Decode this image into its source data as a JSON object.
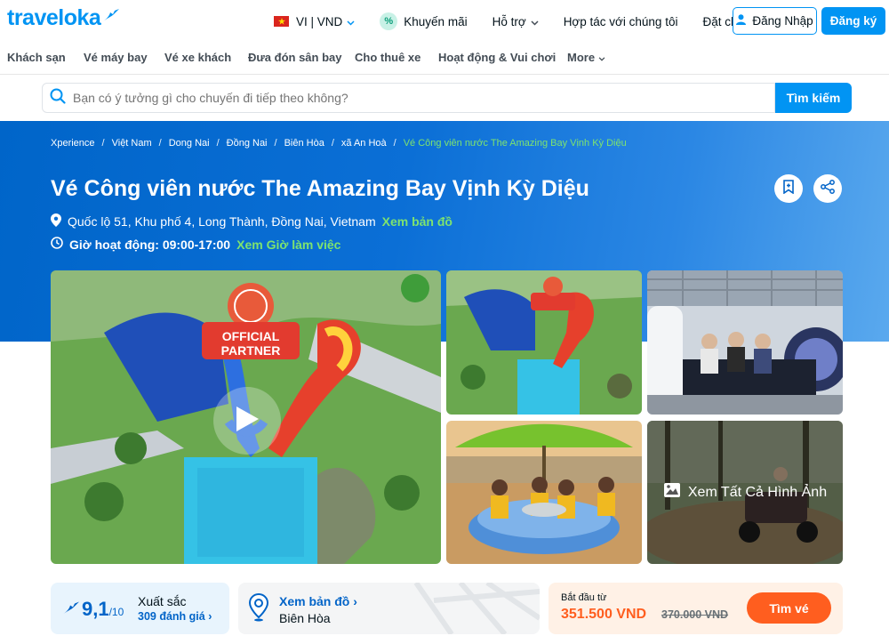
{
  "header": {
    "logo": "traveloka",
    "lang": "VI | VND",
    "promo": "Khuyến mãi",
    "support": "Hỗ trợ",
    "partner": "Hợp tác với chúng tôi",
    "bookings": "Đặt chỗ của tôi",
    "login": "Đăng Nhập",
    "register": "Đăng ký"
  },
  "nav": [
    "Khách sạn",
    "Vé máy bay",
    "Vé xe khách",
    "Đưa đón sân bay",
    "Cho thuê xe",
    "Hoạt động & Vui chơi",
    "More"
  ],
  "search": {
    "placeholder": "Bạn có ý tưởng gì cho chuyến đi tiếp theo không?",
    "button": "Tìm kiếm"
  },
  "breadcrumb": [
    "Xperience",
    "Việt Nam",
    "Dong Nai",
    "Đồng Nai",
    "Biên Hòa",
    "xã An Hoà",
    "Vé Công viên nước The Amazing Bay Vịnh Kỳ Diệu"
  ],
  "product": {
    "title": "Vé Công viên nước The Amazing Bay Vịnh Kỳ Diệu",
    "address": "Quốc lộ 51, Khu phố 4, Long Thành, Đồng Nai, Vietnam",
    "map_link": "Xem bản đồ",
    "hours": "Giờ hoạt động: 09:00-17:00",
    "hours_link": "Xem Giờ làm việc"
  },
  "gallery": {
    "main_sign_1": "OFFICIAL",
    "main_sign_2": "PARTNER",
    "see_all": "Xem Tất Cả Hình Ảnh"
  },
  "rating": {
    "score": "9,1",
    "scale": "/10",
    "label": "Xuất sắc",
    "count": "309 đánh giá"
  },
  "location": {
    "link": "Xem bản đồ",
    "city": "Biên Hòa"
  },
  "price": {
    "from_label": "Bắt đầu từ",
    "current": "351.500 VND",
    "original": "370.000 VND",
    "button": "Tìm vé"
  },
  "colors": {
    "brand": "#0194f3",
    "hero": "#0065c9",
    "accent_green": "#7ee36f",
    "price_orange": "#ff5e1f"
  }
}
